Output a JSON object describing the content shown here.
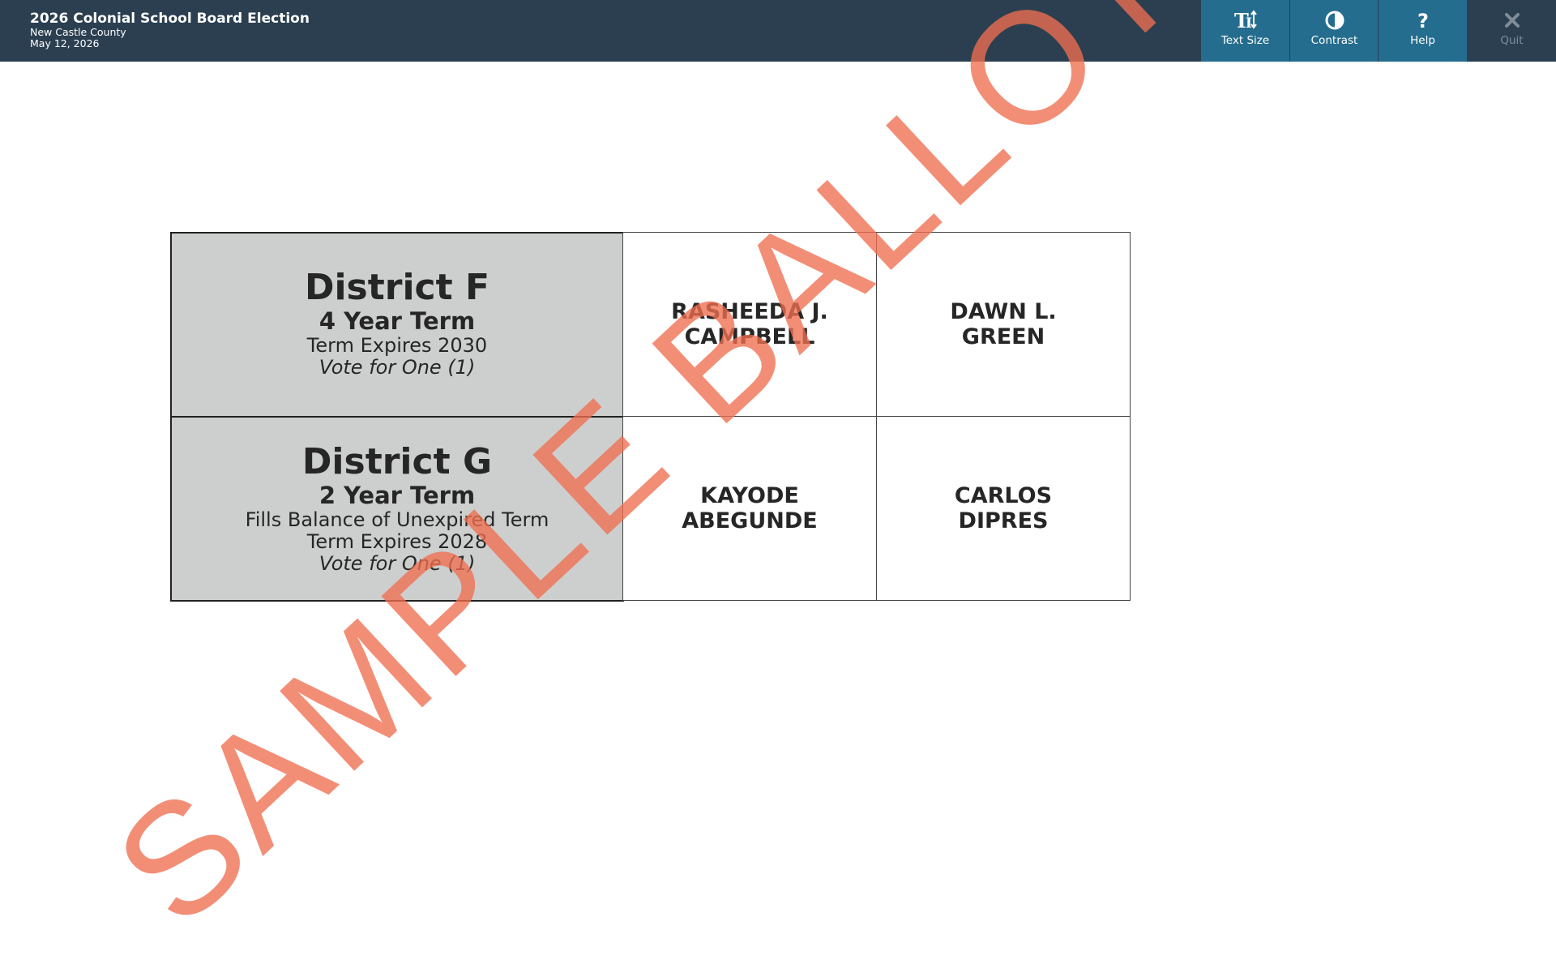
{
  "header": {
    "title": "2026 Colonial School Board Election",
    "county": "New Castle County",
    "date": "May 12, 2026"
  },
  "toolbar": {
    "text_size": {
      "label": "Text Size",
      "icon": "text-size-icon"
    },
    "contrast": {
      "label": "Contrast",
      "icon": "contrast-icon"
    },
    "help": {
      "label": "Help",
      "icon": "help-icon"
    },
    "quit": {
      "label": "Quit",
      "icon": "close-icon"
    }
  },
  "contests": [
    {
      "name": "District F",
      "term": "4 Year Term",
      "lines": [
        "Term Expires 2030"
      ],
      "vote_for": "Vote for One (1)",
      "candidates": [
        "RASHEEDA J.\nCAMPBELL",
        "DAWN L.\nGREEN"
      ]
    },
    {
      "name": "District G",
      "term": "2 Year Term",
      "lines": [
        "Fills Balance of Unexpired Term",
        "Term Expires 2028"
      ],
      "vote_for": "Vote for One (1)",
      "candidates": [
        "KAYODE\nABEGUNDE",
        "CARLOS\nDIPRES"
      ]
    }
  ],
  "watermark": "SAMPLE BALLOT",
  "colors": {
    "header_bg": "#2b3f51",
    "button_bg": "#256d8f",
    "contest_bg": "#cdcfcf",
    "watermark": "#f06e50"
  }
}
